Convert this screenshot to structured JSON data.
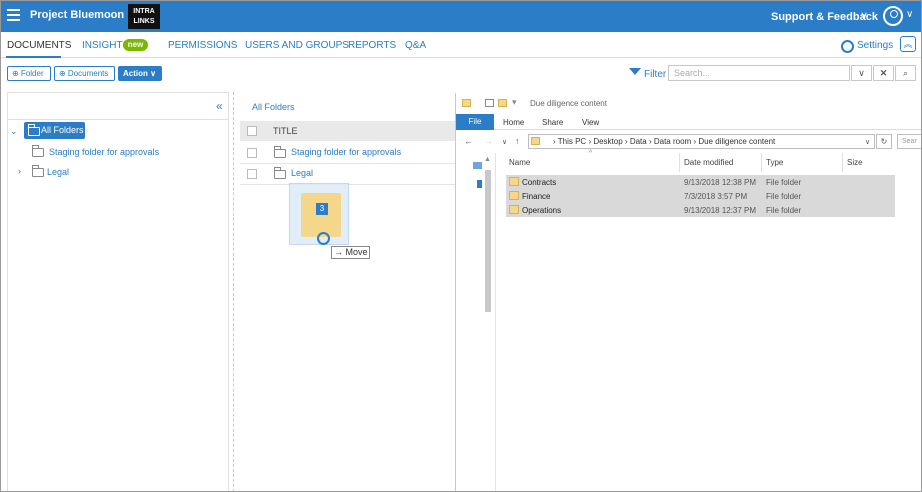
{
  "app": {
    "project_name": "Project Bluemoon",
    "brand_logo": "INTRALINKS",
    "support_label": "Support & Feedback"
  },
  "nav": {
    "tabs": [
      {
        "label": "DOCUMENTS"
      },
      {
        "label": "INSIGHTS"
      },
      {
        "label": "PERMISSIONS"
      },
      {
        "label": "USERS AND GROUPS"
      },
      {
        "label": "REPORTS"
      },
      {
        "label": "Q&A"
      }
    ],
    "insights_badge": "new",
    "settings_label": "Settings"
  },
  "toolbar": {
    "folder_btn": "⊕ Folder",
    "documents_btn": "⊕ Documents",
    "action_btn": "Action",
    "filter_label": "Filter",
    "search_placeholder": "Search..."
  },
  "tree": {
    "root_label": "All Folders",
    "items": [
      {
        "label": "Staging folder for approvals"
      },
      {
        "label": "Legal"
      }
    ]
  },
  "list": {
    "breadcrumb": "All Folders",
    "title_header": "TITLE",
    "rows": [
      {
        "label": "Staging folder for approvals"
      },
      {
        "label": "Legal"
      }
    ]
  },
  "drag": {
    "count": "3",
    "tooltip": "Move"
  },
  "explorer": {
    "window_title": "Due diligence content",
    "ribbon_tabs": [
      "File",
      "Home",
      "Share",
      "View"
    ],
    "address": [
      "This PC",
      "Desktop",
      "Data",
      "Data room",
      "Due diligence content"
    ],
    "address_search": "Sear",
    "columns": [
      "Name",
      "Date modified",
      "Type",
      "Size"
    ],
    "files": [
      {
        "name": "Contracts",
        "date": "9/13/2018 12:38 PM",
        "type": "File folder"
      },
      {
        "name": "Finance",
        "date": "7/3/2018 3:57 PM",
        "type": "File folder"
      },
      {
        "name": "Operations",
        "date": "9/13/2018 12:37 PM",
        "type": "File folder"
      }
    ]
  },
  "colors": {
    "brand_blue": "#2a7dc6",
    "badge_green": "#7ab800",
    "folder_yellow": "#f4d78a"
  }
}
